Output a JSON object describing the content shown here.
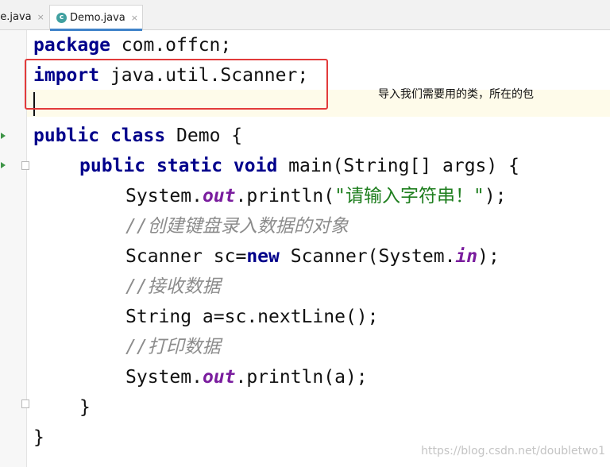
{
  "tabs": [
    {
      "label": "ne.java",
      "close": "×"
    },
    {
      "label": "Demo.java",
      "close": "×",
      "icon_letter": "c"
    }
  ],
  "editor": {
    "lines": {
      "l1": {
        "kw": "package",
        "rest": " com.offcn;"
      },
      "l2": {
        "kw": "import",
        "rest": " java.util.Scanner;"
      },
      "l4": {
        "kw1": "public",
        "kw2": "class",
        "rest": " Demo {"
      },
      "l5": {
        "kw1": "public",
        "kw2": "static",
        "kw3": "void",
        "rest": " main(String[] args) {"
      },
      "l6": {
        "a": "System.",
        "field": "out",
        "b": ".println(",
        "str": "\"请输入字符串！\"",
        "c": ");"
      },
      "l7": {
        "comment": "//创建键盘录入数据的对象"
      },
      "l8": {
        "a": "Scanner sc=",
        "kw": "new",
        "b": " Scanner(System.",
        "field": "in",
        "c": ");"
      },
      "l9": {
        "comment": "//接收数据"
      },
      "l10": {
        "text": "String a=sc.nextLine();"
      },
      "l11": {
        "comment": "//打印数据"
      },
      "l12": {
        "a": "System.",
        "field": "out",
        "b": ".println(a);"
      },
      "l13": {
        "text": "}"
      },
      "l14": {
        "text": "}"
      }
    }
  },
  "annotation": {
    "text": "导入我们需要用的类，所在的包"
  },
  "watermark": {
    "text": "https://blog.csdn.net/doubletwo1"
  },
  "colors": {
    "keyword": "#00008b",
    "string": "#1e7e1e",
    "comment": "#8c8c8c",
    "static_field": "#7a1d9e",
    "highlight_box": "#e23b3b",
    "caret_row": "#fefbea"
  }
}
